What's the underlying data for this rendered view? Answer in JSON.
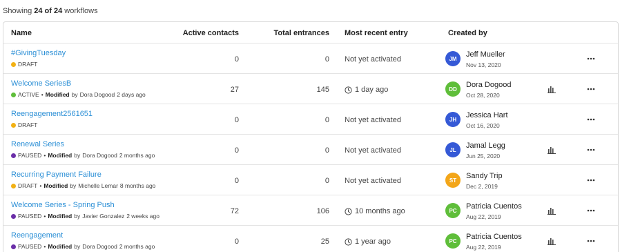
{
  "summary": {
    "prefix": "Showing",
    "count": "24 of 24",
    "suffix": "workflows"
  },
  "headers": {
    "name": "Name",
    "active": "Active contacts",
    "total": "Total entrances",
    "recent": "Most recent entry",
    "created": "Created by"
  },
  "colors": {
    "link": "#2b8fd6",
    "draft": "#f2b114",
    "active": "#5fbe3a",
    "paused": "#6b2fa8",
    "avatar_blue": "#3559d6",
    "avatar_green": "#5fbe3a",
    "avatar_orange": "#f3a619"
  },
  "rows": [
    {
      "name": "#GivingTuesday",
      "status": "DRAFT",
      "status_color": "#f2b114",
      "modified_label": "",
      "modified_by_prefix": "",
      "modified_by": "",
      "modified_when": "",
      "active": "0",
      "total": "0",
      "recent": "Not yet activated",
      "recent_icon": "",
      "avatar": "JM",
      "avatar_color": "#3559d6",
      "creator": "Jeff Mueller",
      "created": "Nov 13, 2020",
      "has_report": false
    },
    {
      "name": "Welcome SeriesB",
      "status": "ACTIVE",
      "status_color": "#5fbe3a",
      "modified_label": "Modified",
      "modified_by_prefix": "by",
      "modified_by": "Dora Dogood",
      "modified_when": "2 days ago",
      "active": "27",
      "total": "145",
      "recent": "1 day ago",
      "recent_icon": "clock-icon",
      "avatar": "DD",
      "avatar_color": "#5fbe3a",
      "creator": "Dora Dogood",
      "created": "Oct 28, 2020",
      "has_report": true
    },
    {
      "name": "Reengagement2561651",
      "status": "DRAFT",
      "status_color": "#f2b114",
      "modified_label": "",
      "modified_by_prefix": "",
      "modified_by": "",
      "modified_when": "",
      "active": "0",
      "total": "0",
      "recent": "Not yet activated",
      "recent_icon": "",
      "avatar": "JH",
      "avatar_color": "#3559d6",
      "creator": "Jessica Hart",
      "created": "Oct 16, 2020",
      "has_report": false
    },
    {
      "name": "Renewal Series",
      "status": "PAUSED",
      "status_color": "#6b2fa8",
      "modified_label": "Modified",
      "modified_by_prefix": "by",
      "modified_by": "Dora Dogood",
      "modified_when": "2 months ago",
      "active": "0",
      "total": "0",
      "recent": "Not yet activated",
      "recent_icon": "",
      "avatar": "JL",
      "avatar_color": "#3559d6",
      "creator": "Jamal Legg",
      "created": "Jun 25, 2020",
      "has_report": true
    },
    {
      "name": "Recurring Payment Failure",
      "status": "DRAFT",
      "status_color": "#f2b114",
      "modified_label": "Modified",
      "modified_by_prefix": "by",
      "modified_by": "Michelle Lemar",
      "modified_when": "8 months ago",
      "active": "0",
      "total": "0",
      "recent": "Not yet activated",
      "recent_icon": "",
      "avatar": "ST",
      "avatar_color": "#f3a619",
      "creator": "Sandy Trip",
      "created": "Dec 2, 2019",
      "has_report": false
    },
    {
      "name": "Welcome Series - Spring Push",
      "status": "PAUSED",
      "status_color": "#6b2fa8",
      "modified_label": "Modified",
      "modified_by_prefix": "by",
      "modified_by": "Javier Gonzalez",
      "modified_when": "2 weeks ago",
      "active": "72",
      "total": "106",
      "recent": "10 months ago",
      "recent_icon": "clock-icon",
      "avatar": "PC",
      "avatar_color": "#5fbe3a",
      "creator": "Patricia Cuentos",
      "created": "Aug 22, 2019",
      "has_report": true
    },
    {
      "name": "Reengagement",
      "status": "PAUSED",
      "status_color": "#6b2fa8",
      "modified_label": "Modified",
      "modified_by_prefix": "by",
      "modified_by": "Dora Dogood",
      "modified_when": "2 months ago",
      "active": "0",
      "total": "25",
      "recent": "1 year ago",
      "recent_icon": "clock-icon",
      "avatar": "PC",
      "avatar_color": "#5fbe3a",
      "creator": "Patricia Cuentos",
      "created": "Aug 22, 2019",
      "has_report": true
    }
  ]
}
